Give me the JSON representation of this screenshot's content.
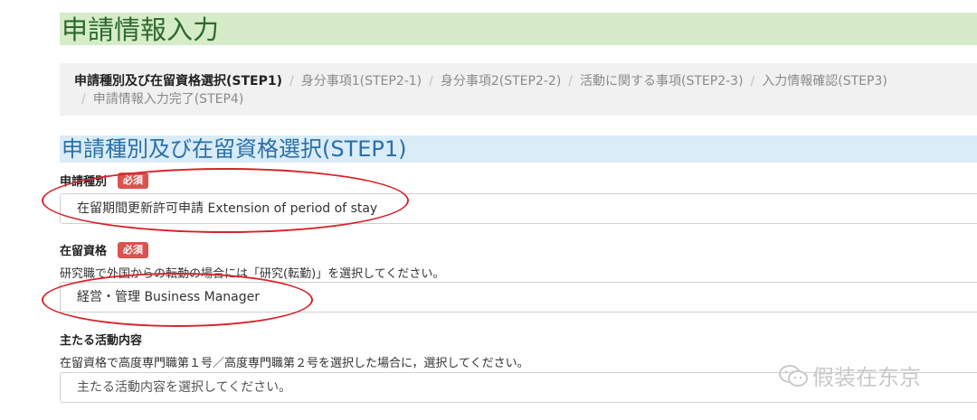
{
  "header": {
    "title": "申請情報入力"
  },
  "breadcrumb": {
    "steps": [
      {
        "label": "申請種別及び在留資格選択(STEP1)"
      },
      {
        "label": "身分事項1(STEP2-1)"
      },
      {
        "label": "身分事項2(STEP2-2)"
      },
      {
        "label": "活動に関する事項(STEP2-3)"
      },
      {
        "label": "入力情報確認(STEP3)"
      },
      {
        "label": "申請情報入力完了(STEP4)"
      }
    ],
    "separator": "/"
  },
  "section": {
    "title": "申請種別及び在留資格選択(STEP1)"
  },
  "form": {
    "application_type": {
      "label": "申請種別",
      "required": "必須",
      "value": "在留期間更新許可申請 Extension of period of stay"
    },
    "residence_status": {
      "label": "在留資格",
      "required": "必須",
      "help": "研究職で外国からの転勤の場合には「研究(転勤)」を選択してください。",
      "value": "経営・管理 Business Manager"
    },
    "main_activity": {
      "label": "主たる活動内容",
      "help": "在留資格で高度専門職第１号／高度専門職第２号を選択した場合に，選択してください。",
      "placeholder": "主たる活動内容を選択してください。"
    }
  },
  "watermark": {
    "text": "假装在东京",
    "icon": "wechat-icon"
  },
  "colors": {
    "header_bg": "#d6ecc9",
    "header_text": "#2d6a2d",
    "section_bg": "#d9ecf7",
    "section_text": "#2a6fa8",
    "required_badge": "#d9534f",
    "annotation": "#d8232a"
  }
}
